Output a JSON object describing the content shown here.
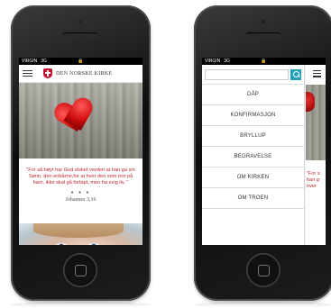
{
  "left_phone": {
    "status": {
      "carrier": "VIRGIN",
      "network": "3G"
    },
    "header": {
      "brand": "DEN NORSKE KIRKE"
    },
    "verse": {
      "text": "\"For så høyt har Gud elsket verden at han ga sin Sønn, den enbårne,for at hver den som tror på ham, ikke skal gå fortapt, men ha evig liv. \"",
      "separator": "• • •",
      "reference": "Johannes 3,16"
    }
  },
  "right_phone": {
    "status": {
      "carrier": "VIRGIN",
      "network": "3G"
    },
    "menu": {
      "items": [
        "DÅP",
        "KONFIRMASJON",
        "BRYLLUP",
        "BEGRAVELSE",
        "OM KIRKEN",
        "OM TROEN"
      ]
    },
    "peek_text": "\"For s\nhan g\nhver"
  },
  "colors": {
    "accent": "#c0272d",
    "search": "#22a1b7"
  },
  "icons": [
    "hamburger-menu-icon",
    "church-logo-icon",
    "lock-icon",
    "search-icon",
    "home-button-icon"
  ]
}
